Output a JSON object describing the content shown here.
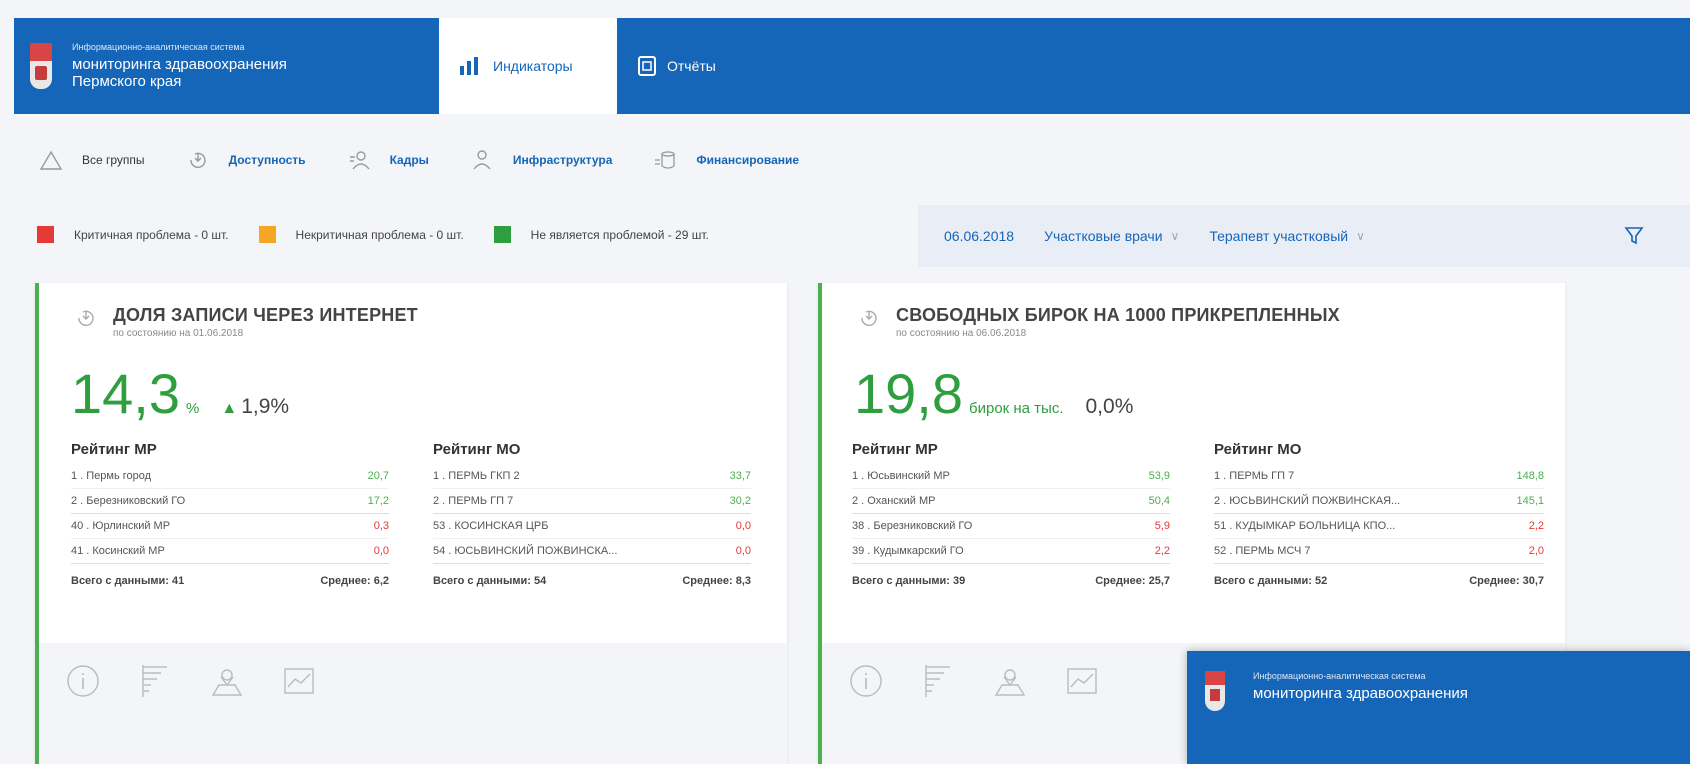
{
  "header": {
    "brand_small": "Информационно-аналитическая система",
    "brand_line1": "мониторинга здравоохранения",
    "brand_line2": "Пермского края",
    "tabs": [
      {
        "label": "Индикаторы",
        "icon": "bar-chart-icon",
        "active": true
      },
      {
        "label": "Отчёты",
        "icon": "report-icon",
        "active": false
      }
    ]
  },
  "groups": [
    {
      "label": "Все группы",
      "icon": "warning-triangle-icon"
    },
    {
      "label": "Доступность",
      "icon": "accessibility-icon"
    },
    {
      "label": "Кадры",
      "icon": "staff-icon"
    },
    {
      "label": "Инфраструктура",
      "icon": "infrastructure-icon"
    },
    {
      "label": "Финансирование",
      "icon": "finance-icon"
    }
  ],
  "legend": [
    {
      "label": "Критичная проблема - 0 шт.",
      "color": "#e53935"
    },
    {
      "label": "Некритичная проблема - 0 шт.",
      "color": "#f5a623"
    },
    {
      "label": "Не является проблемой - 29 шт.",
      "color": "#2e9e3f"
    }
  ],
  "filters": {
    "date": "06.06.2018",
    "category": "Участковые врачи",
    "specialty": "Терапевт участковый"
  },
  "cards": [
    {
      "title": "ДОЛЯ ЗАПИСИ ЧЕРЕЗ ИНТЕРНЕТ",
      "asof": "по состоянию на 01.06.2018",
      "value": "14,3",
      "unit": "%",
      "delta": "1,9%",
      "rating_mr": {
        "heading": "Рейтинг МР",
        "rows": [
          {
            "name": "1 . Пермь город",
            "value": "20,7"
          },
          {
            "name": "2 . Березниковский ГО",
            "value": "17,2"
          },
          {
            "name": "40 . Юрлинский МР",
            "value": "0,3"
          },
          {
            "name": "41 . Косинский МР",
            "value": "0,0"
          }
        ],
        "total": "Всего с данными: 41",
        "avg": "Среднее: 6,2"
      },
      "rating_mo": {
        "heading": "Рейтинг МО",
        "rows": [
          {
            "name": "1 . ПЕРМЬ ГКП 2",
            "value": "33,7"
          },
          {
            "name": "2 . ПЕРМЬ ГП 7",
            "value": "30,2"
          },
          {
            "name": "53 . КОСИНСКАЯ ЦРБ",
            "value": "0,0"
          },
          {
            "name": "54 . ЮСЬВИНСКИЙ ПОЖВИНСКА...",
            "value": "0,0"
          }
        ],
        "total": "Всего с данными: 54",
        "avg": "Среднее: 8,3"
      }
    },
    {
      "title": "СВОБОДНЫХ БИРОК НА 1000 ПРИКРЕПЛЕННЫХ",
      "asof": "по состоянию на 06.06.2018",
      "value": "19,8",
      "unit": "бирок на тыс.",
      "delta": "0,0%",
      "rating_mr": {
        "heading": "Рейтинг МР",
        "rows": [
          {
            "name": "1 . Юсьвинский МР",
            "value": "53,9"
          },
          {
            "name": "2 . Оханский МР",
            "value": "50,4"
          },
          {
            "name": "38 . Березниковский ГО",
            "value": "5,9"
          },
          {
            "name": "39 . Кудымкарский ГО",
            "value": "2,2"
          }
        ],
        "total": "Всего с данными: 39",
        "avg": "Среднее: 25,7"
      },
      "rating_mo": {
        "heading": "Рейтинг МО",
        "rows": [
          {
            "name": "1 . ПЕРМЬ ГП 7",
            "value": "148,8"
          },
          {
            "name": "2 . ЮСЬВИНСКИЙ ПОЖВИНСКАЯ...",
            "value": "145,1"
          },
          {
            "name": "51 . КУДЫМКАР БОЛЬНИЦА КПО...",
            "value": "2,2"
          },
          {
            "name": "52 . ПЕРМЬ МСЧ 7",
            "value": "2,0"
          }
        ],
        "total": "Всего с данными: 52",
        "avg": "Среднее: 30,7"
      }
    }
  ],
  "preview": {
    "small": "Информационно-аналитическая система",
    "big": "мониторинга здравоохранения"
  }
}
